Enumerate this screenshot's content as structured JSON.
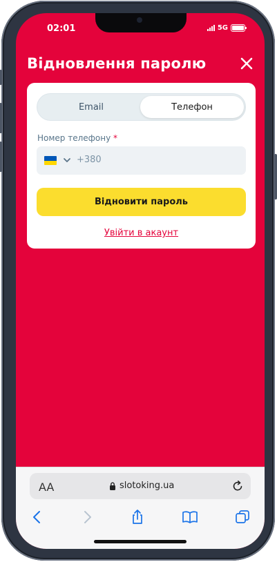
{
  "status_bar": {
    "time": "02:01",
    "network": "5G"
  },
  "dialog": {
    "title": "Відновлення паролю",
    "tabs": [
      {
        "label": "Email"
      },
      {
        "label": "Телефон",
        "active": true
      }
    ],
    "phone_field": {
      "label": "Номер телефону",
      "required_mark": "*",
      "prefix": "+380",
      "country": "UA"
    },
    "submit_label": "Відновити пароль",
    "login_link": "Увійти в акаунт"
  },
  "browser": {
    "aa_label": "AA",
    "url": "slotoking.ua",
    "toolbar_icons": [
      "back-icon",
      "forward-icon",
      "share-icon",
      "bookmarks-icon",
      "tabs-icon"
    ]
  },
  "colors": {
    "brand_red": "#e4033b",
    "button_yellow": "#fbdd2e"
  }
}
